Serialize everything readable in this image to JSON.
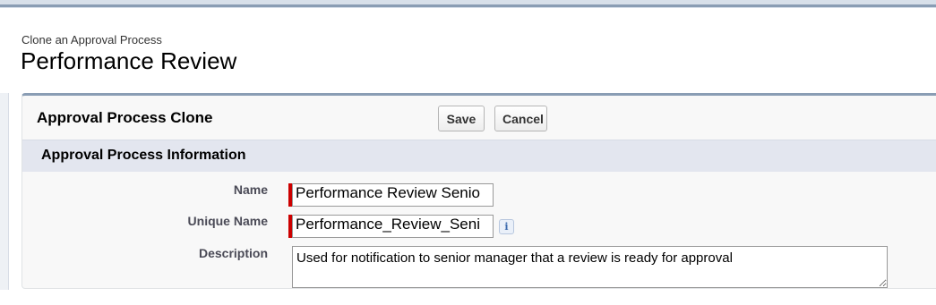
{
  "header": {
    "subtitle": "Clone an Approval Process",
    "title": "Performance Review"
  },
  "panel": {
    "title": "Approval Process Clone",
    "save_label": "Save",
    "cancel_label": "Cancel"
  },
  "section": {
    "title": "Approval Process Information"
  },
  "fields": {
    "name": {
      "label": "Name",
      "value": "Performance Review Senio"
    },
    "unique_name": {
      "label": "Unique Name",
      "value": "Performance_Review_Seni",
      "info_icon": "info-icon"
    },
    "description": {
      "label": "Description",
      "value": "Used for notification to senior manager that a review is ready for approval"
    }
  },
  "colors": {
    "required": "#cc0000",
    "accent": "#8a9db4",
    "section_bg": "#e3e6ef"
  }
}
